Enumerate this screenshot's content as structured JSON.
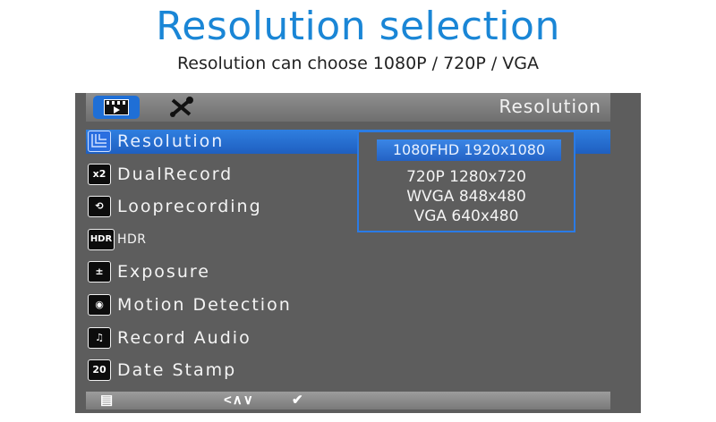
{
  "heading": {
    "title": "Resolution selection",
    "subtitle": "Resolution can choose 1080P / 720P / VGA"
  },
  "screen": {
    "header_title": "Resolution",
    "tabs": [
      {
        "name": "video-tab",
        "icon": "clapperboard-icon",
        "active": true
      },
      {
        "name": "tools-tab",
        "icon": "wrench-screwdriver-icon",
        "active": false
      }
    ],
    "menu": [
      {
        "label": "Resolution",
        "icon": "resolution-icon",
        "icon_text": "",
        "selected": true
      },
      {
        "label": "DualRecord",
        "icon": "dual-record-icon",
        "icon_text": "x2",
        "selected": false
      },
      {
        "label": "Looprecording",
        "icon": "loop-recording-icon",
        "icon_text": "⟲",
        "selected": false
      },
      {
        "label": "HDR",
        "icon": "hdr-icon",
        "icon_text": "HDR",
        "selected": false
      },
      {
        "label": "Exposure",
        "icon": "exposure-icon",
        "icon_text": "±",
        "selected": false
      },
      {
        "label": "Motion Detection",
        "icon": "motion-detection-icon",
        "icon_text": "◉",
        "selected": false
      },
      {
        "label": "Record Audio",
        "icon": "record-audio-icon",
        "icon_text": "♫",
        "selected": false
      },
      {
        "label": "Date Stamp",
        "icon": "date-stamp-icon",
        "icon_text": "20",
        "selected": false
      }
    ],
    "resolution_options": [
      {
        "label": "1080FHD 1920x1080",
        "selected": true
      },
      {
        "label": "720P 1280x720",
        "selected": false
      },
      {
        "label": "WVGA 848x480",
        "selected": false
      },
      {
        "label": "VGA 640x480",
        "selected": false
      }
    ],
    "bottom_bar": {
      "menu_icon": "▤",
      "nav_icons": "<∧∨",
      "ok_icon": "✔"
    }
  },
  "colors": {
    "accent": "#1a86d6",
    "highlight": "#2f7fe0",
    "screen_bg": "#5d5d5d"
  }
}
